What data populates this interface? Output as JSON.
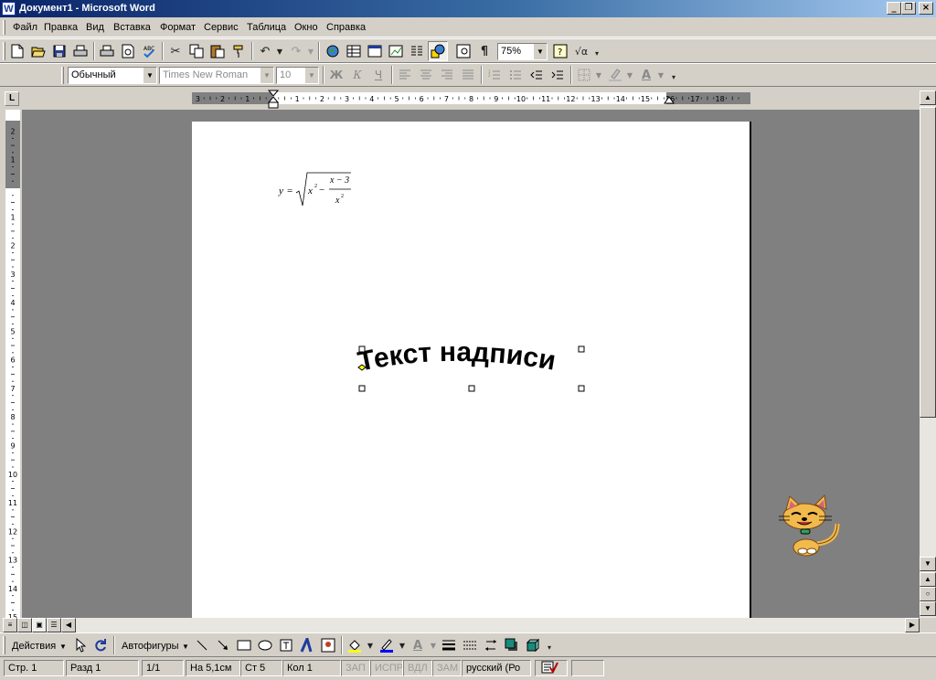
{
  "window": {
    "title": "Документ1 - Microsoft Word",
    "icon": "word-app-icon",
    "controls": [
      "minimize-icon",
      "restore-icon",
      "close-icon"
    ]
  },
  "menu": [
    "Файл",
    "Правка",
    "Вид",
    "Вставка",
    "Формат",
    "Сервис",
    "Таблица",
    "Окно",
    "Справка"
  ],
  "standard_toolbar": {
    "buttons": [
      "new-document-icon",
      "open-icon",
      "save-icon",
      "print-icon",
      "print-preview-icon",
      "spelling-icon",
      "cut-icon",
      "copy-icon",
      "paste-icon",
      "format-painter-icon",
      "undo-icon",
      "redo-icon",
      "web-icon",
      "tables-borders-icon",
      "insert-table-icon",
      "insert-excel-icon",
      "columns-icon",
      "drawing-icon",
      "document-map-icon",
      "show-hide-icon",
      "help-icon",
      "equation-icon"
    ],
    "zoom": "75%"
  },
  "formatting_toolbar": {
    "style": "Обычный",
    "font": "Times New Roman",
    "size": "10",
    "bold": "Ж",
    "italic": "К",
    "underline": "Ч",
    "font_color_letter": "A"
  },
  "ruler": {
    "h_left": [
      "3",
      "2",
      "1"
    ],
    "h_right": [
      "1",
      "2",
      "3",
      "4",
      "5",
      "6",
      "7",
      "8",
      "9",
      "10",
      "11",
      "12",
      "13",
      "14",
      "15",
      "16",
      "17",
      "18"
    ],
    "v_top": [
      "2",
      "1"
    ],
    "v_bottom": [
      "1",
      "2",
      "3",
      "4",
      "5",
      "6",
      "7",
      "8",
      "9",
      "10",
      "11",
      "12",
      "13",
      "14",
      "15",
      "16"
    ]
  },
  "document": {
    "formula": {
      "lhs": "y",
      "eq": "=",
      "x": "x",
      "exp": "2",
      "minus": "−",
      "numerator": "x − 3",
      "den_x": "x",
      "den_exp": "2"
    },
    "wordart_text": "Текст надписи"
  },
  "drawing_toolbar": {
    "actions": "Действия",
    "autoshapes": "Автофигуры",
    "font_color_letter": "A"
  },
  "statusbar": {
    "page": "Стр. 1",
    "section": "Разд 1",
    "pages": "1/1",
    "at": "На 5,1см",
    "line": "Ст 5",
    "col": "Кол 1",
    "rec": "ЗАП",
    "trk": "ИСПР",
    "ext": "ВДЛ",
    "ovr": "ЗАМ",
    "lang": "русский (Ро"
  },
  "colors": {
    "title_start": "#0a246a",
    "title_end": "#a6caf0",
    "chrome": "#d4d0c8",
    "workspace": "#808080",
    "fill_accent": "#ffff00",
    "line_accent": "#0000ff",
    "font_accent": "#ff0000"
  }
}
